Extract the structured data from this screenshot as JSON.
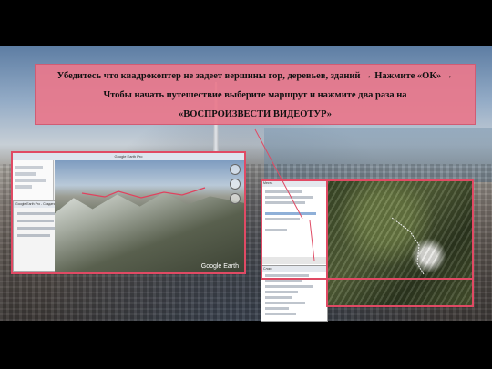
{
  "banner": {
    "line1": "Убедитесь что квадрокоптер не задеет вершины гор, деревьев, зданий → Нажмите «ОК» →",
    "line2": "Чтобы начать путешествие выберите маршрут и нажмите два раза на",
    "line3": "«ВОСПРОИЗВЕСТИ ВИДЕОТУР»"
  },
  "left_window": {
    "title": "Google Earth Pro",
    "sub_panel_title": "Google Earth Pro - Создать тур",
    "logo": "Google Earth"
  },
  "right_window": {
    "list_title": "Места",
    "places_title": "Слои"
  },
  "colors": {
    "banner_bg": "#e8788c",
    "accent_border": "#e04a64"
  }
}
